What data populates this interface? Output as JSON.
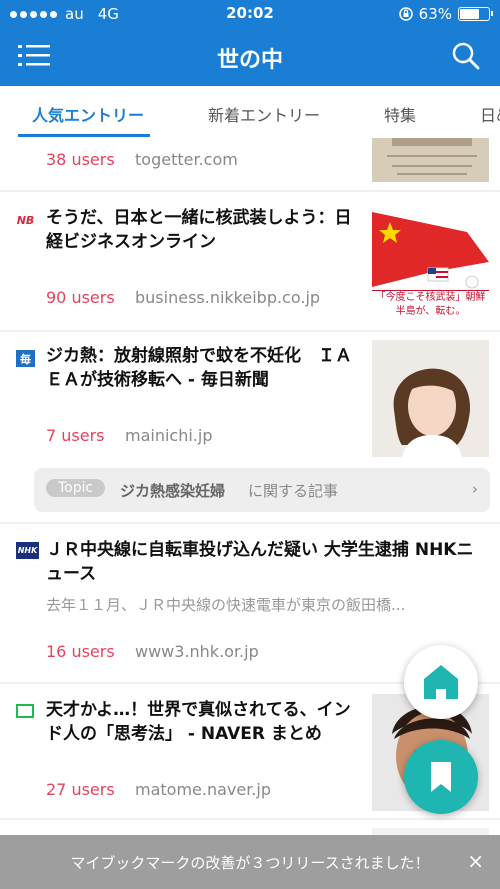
{
  "status_bar": {
    "carrier": "au",
    "network": "4G",
    "time": "20:02",
    "battery": "63%",
    "battery_level": 0.63
  },
  "header": {
    "title": "世の中"
  },
  "tabs": [
    {
      "label": "人気エントリー"
    },
    {
      "label": "新着エントリー"
    },
    {
      "label": "特集"
    },
    {
      "label": "日め"
    }
  ],
  "entries": [
    {
      "users": "38 users",
      "domain": "togetter.com"
    },
    {
      "favicon": "NB",
      "title": "そうだ、日本と一緒に核武装しよう：日経ビジネスオンライン",
      "users": "90 users",
      "domain": "business.nikkeibp.co.jp",
      "thumb_caption": "「今度こそ核武装」朝鮮半島が、転む。"
    },
    {
      "favicon": "毎",
      "title": "ジカ熱：放射線照射で蚊を不妊化　ＩＡＥＡが技術移転へ - 毎日新聞",
      "users": "7 users",
      "domain": "mainichi.jp",
      "topic": {
        "pill": "Topic",
        "name": "ジカ熱感染妊婦",
        "suffix": "に関する記事",
        "chevron": "›"
      }
    },
    {
      "favicon": "NHK",
      "title": "ＪＲ中央線に自転車投げ込んだ疑い 大学生逮捕 NHKニュース",
      "snippet": "去年１１月、ＪＲ中央線の快速電車が東京の飯田橋...",
      "users": "16 users",
      "domain": "www3.nhk.or.jp"
    },
    {
      "title": "天才かよ…！世界で真似されてる、インド人の「思考法」 - NAVER まとめ",
      "users": "27 users",
      "domain": "matome.naver.jp"
    }
  ],
  "toast": {
    "message": "マイブックマークの改善が３つリリースされました！",
    "close": "×"
  },
  "colors": {
    "primary": "#1a7fd4",
    "users": "#e8415b",
    "fab": "#1fb5b1"
  }
}
